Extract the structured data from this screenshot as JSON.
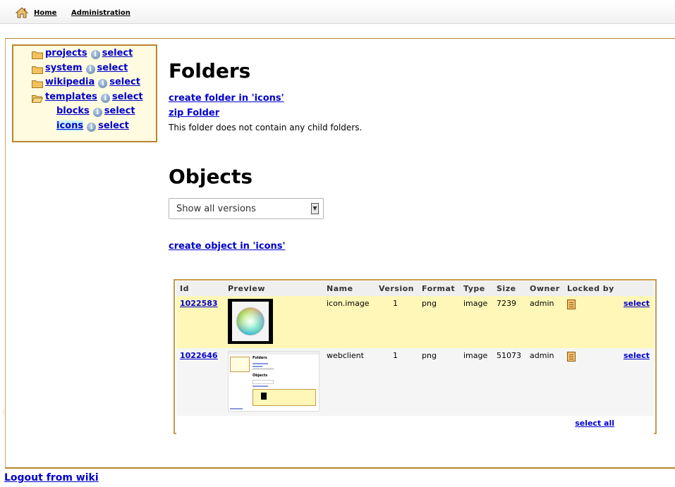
{
  "nav": {
    "home_label": "Home",
    "admin_label": "Administration",
    "home_icon": "home-icon"
  },
  "tree": {
    "items": [
      {
        "label": "projects",
        "select_label": "select",
        "info_icon": "info-icon",
        "folder_icon": "folder-closed-icon"
      },
      {
        "label": "system",
        "select_label": "select",
        "info_icon": "info-icon",
        "folder_icon": "folder-closed-icon"
      },
      {
        "label": "wikipedia",
        "select_label": "select",
        "info_icon": "info-icon",
        "folder_icon": "folder-closed-icon"
      },
      {
        "label": "templates",
        "select_label": "select",
        "info_icon": "info-icon",
        "folder_icon": "folder-open-icon"
      },
      {
        "label": "blocks",
        "select_label": "select",
        "info_icon": "info-icon"
      },
      {
        "label": "icons",
        "select_label": "select",
        "info_icon": "info-icon",
        "current": true
      }
    ]
  },
  "folders": {
    "heading": "Folders",
    "create_link": "create folder in 'icons'",
    "zip_link": "zip Folder",
    "note": "This folder does not contain any child folders."
  },
  "objects": {
    "heading": "Objects",
    "version_select": "Show all versions",
    "create_link": "create object in 'icons'",
    "columns": [
      "Id",
      "Preview",
      "Name",
      "Version",
      "Format",
      "Type",
      "Size",
      "Owner",
      "Locked by"
    ],
    "rows": [
      {
        "id": "1022583",
        "name": "icon.image",
        "version": "1",
        "format": "png",
        "type": "image",
        "size": "7239",
        "owner": "admin",
        "locked_icon": "document-icon",
        "select_label": "select"
      },
      {
        "id": "1022646",
        "name": "webclient",
        "version": "1",
        "format": "png",
        "type": "image",
        "size": "51073",
        "owner": "admin",
        "locked_icon": "document-icon",
        "select_label": "select"
      }
    ],
    "select_all": "select all",
    "preview_thumb_text": {
      "heading": "Folders",
      "subheading": "Objects"
    }
  },
  "footer": {
    "logout": "Logout from wiki"
  },
  "colors": {
    "link": "#0000cc",
    "frame_border": "#b8862b",
    "tree_bg": "#fffbe0",
    "row_highlight": "#fff7b7"
  }
}
